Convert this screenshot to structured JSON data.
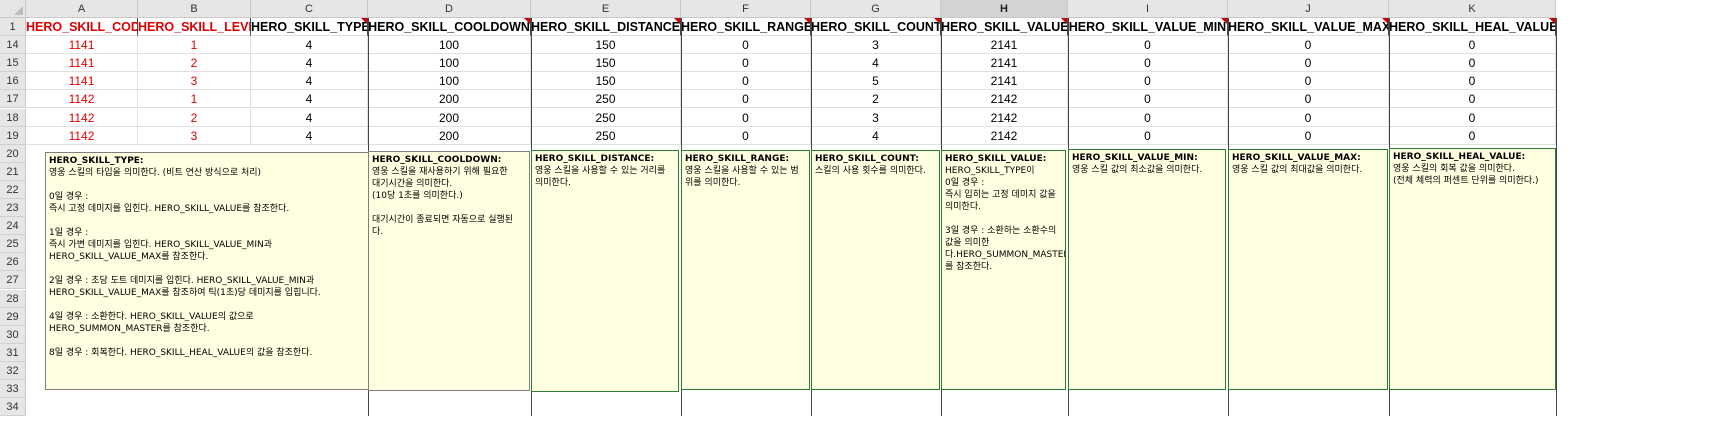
{
  "columns": [
    "A",
    "B",
    "C",
    "D",
    "E",
    "F",
    "G",
    "H",
    "I",
    "J",
    "K"
  ],
  "rows": [
    "1",
    "14",
    "15",
    "16",
    "17",
    "18",
    "19",
    "20",
    "21",
    "22",
    "23",
    "24",
    "25",
    "26",
    "27",
    "28",
    "29",
    "30",
    "31",
    "32",
    "33",
    "34"
  ],
  "headers": [
    "HERO_SKILL_CODE",
    "HERO_SKILL_LEVEL",
    "HERO_SKILL_TYPE",
    "HERO_SKILL_COOLDOWN",
    "HERO_SKILL_DISTANCE",
    "HERO_SKILL_RANGE",
    "HERO_SKILL_COUNT",
    "HERO_SKILL_VALUE",
    "HERO_SKILL_VALUE_MIN",
    "HERO_SKILL_VALUE_MAX",
    "HERO_SKILL_HEAL_VALUE"
  ],
  "data": [
    [
      "1141",
      "1",
      "4",
      "100",
      "150",
      "0",
      "3",
      "2141",
      "0",
      "0",
      "0"
    ],
    [
      "1141",
      "2",
      "4",
      "100",
      "150",
      "0",
      "4",
      "2141",
      "0",
      "0",
      "0"
    ],
    [
      "1141",
      "3",
      "4",
      "100",
      "150",
      "0",
      "5",
      "2141",
      "0",
      "0",
      "0"
    ],
    [
      "1142",
      "1",
      "4",
      "200",
      "250",
      "0",
      "2",
      "2142",
      "0",
      "0",
      "0"
    ],
    [
      "1142",
      "2",
      "4",
      "200",
      "250",
      "0",
      "3",
      "2142",
      "0",
      "0",
      "0"
    ],
    [
      "1142",
      "3",
      "4",
      "200",
      "250",
      "0",
      "4",
      "2142",
      "0",
      "0",
      "0"
    ]
  ],
  "selected_column": "H",
  "colors": {
    "red_text": "#e00000",
    "note_bg": "#ffffe1",
    "comment_marker": "#d00000"
  },
  "notes": [
    {
      "title": "HERO_SKILL_TYPE:",
      "body": "영웅 스킬의 타입을 의미한다. (비트 연산 방식으로 처리)\n\n0일 경우 :\n즉시 고정 데미지를 입힌다. HERO_SKILL_VALUE를 참조한다.\n\n1일 경우 :\n즉시 가변 데미지를 입힌다. HERO_SKILL_VALUE_MIN과\nHERO_SKILL_VALUE_MAX를 참조한다.\n\n2일 경우 : 초당 도트 데미지를 입힌다. HERO_SKILL_VALUE_MIN과\nHERO_SKILL_VALUE_MAX를 참조하여 틱(1초)당 데미지를 입힙니다.\n\n4일 경우 : 소환한다. HERO_SKILL_VALUE의 값으로\nHERO_SUMMON_MASTER를 참조한다.\n\n8일 경우 : 회복한다. HERO_SKILL_HEAL_VALUE의 값을 참조한다."
    },
    {
      "title": "HERO_SKILL_COOLDOWN:",
      "body": "영웅 스킬을 재사용하기 위해 필요한\n대기시간을 의미한다.\n(10당 1초를 의미한다.)\n\n대기시간이 종료되면 자동으로 실행된\n다."
    },
    {
      "title": "HERO_SKILL_DISTANCE:",
      "body": "영웅 스킬을 사용할 수 있는 거리를\n의미한다."
    },
    {
      "title": "HERO_SKILL_RANGE:",
      "body": "영웅 스킬을 사용할 수 있는 범\n위를 의미한다."
    },
    {
      "title": "HERO_SKILL_COUNT:",
      "body": "스킬의 사용 횟수를 의미한다."
    },
    {
      "title": "HERO_SKILL_VALUE:",
      "body": "HERO_SKILL_TYPE이\n0일 경우 :\n즉시 입히는 고정 데미지 값을\n의미한다.\n\n3일 경우 : 소환하는 소환수의\n값을 의미한\n다.HERO_SUMMON_MASTER\n를 참조한다."
    },
    {
      "title": "HERO_SKILL_VALUE_MIN:",
      "body": "영웅 스킬 값의 최소값을 의미한다."
    },
    {
      "title": "HERO_SKILL_VALUE_MAX:",
      "body": "영웅 스킬 값의 최대값을 의미한다."
    },
    {
      "title": "HERO_SKILL_HEAL_VALUE:",
      "body": "영웅 스킬의 회복 값을 의미한다.\n(전체 체력의 퍼센트 단위를 의미한다.)"
    }
  ]
}
